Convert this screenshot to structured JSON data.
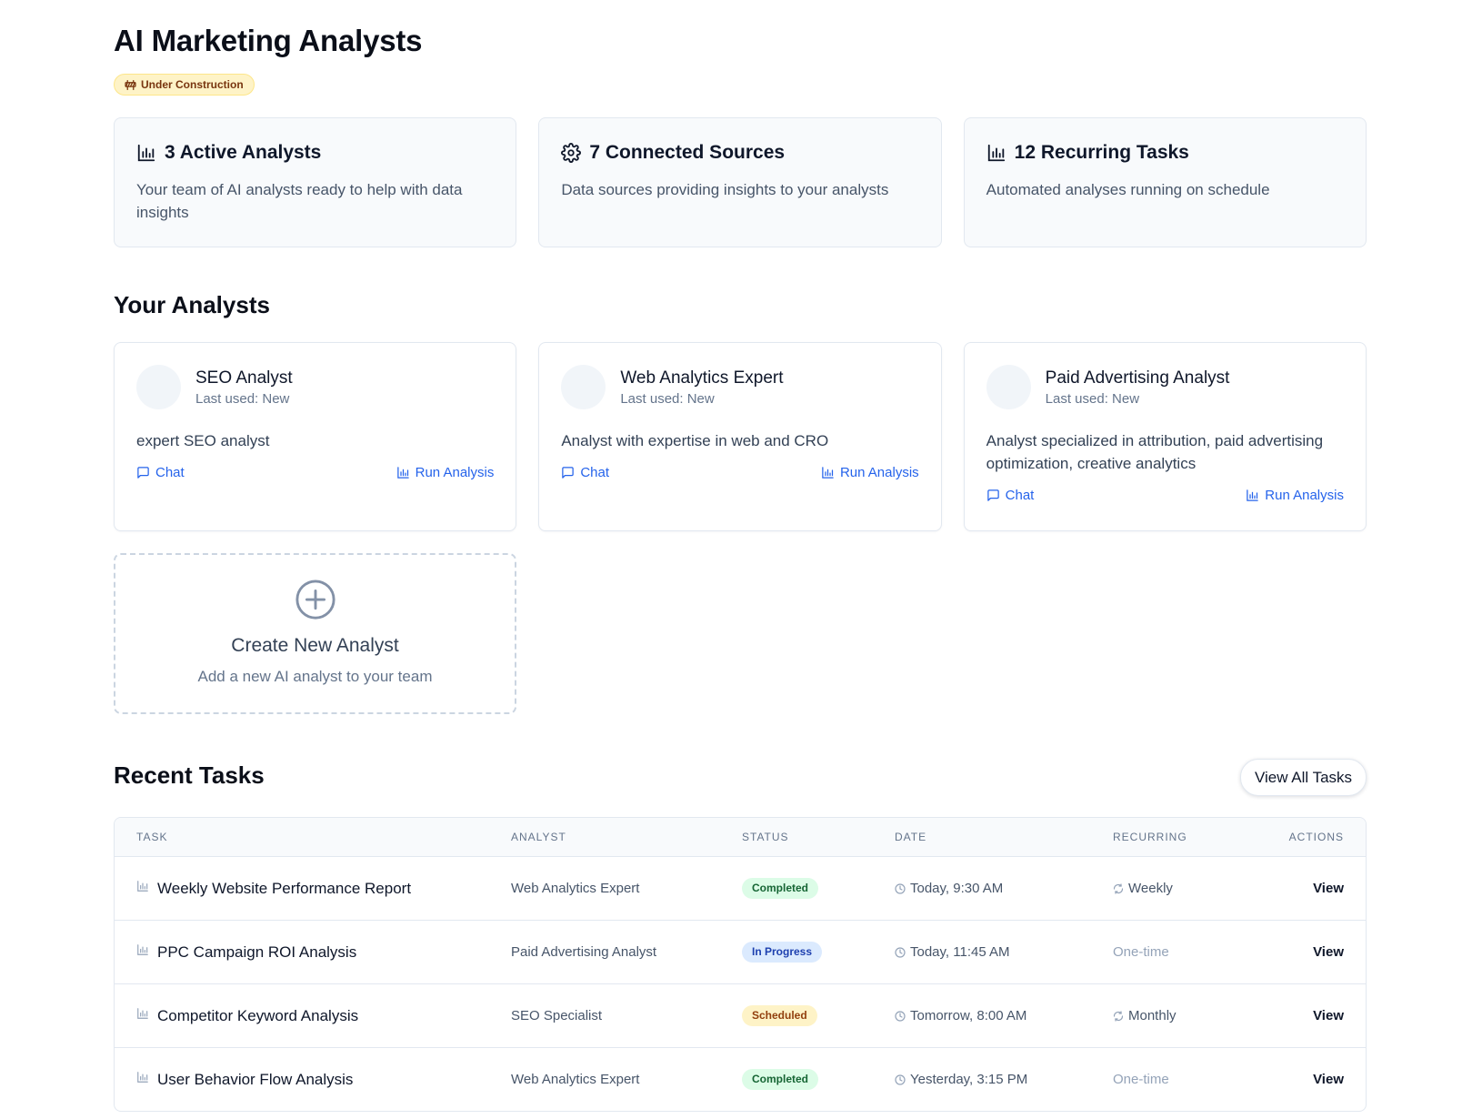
{
  "page": {
    "title": "AI Marketing Analysts",
    "badge": "Under Construction"
  },
  "stats": [
    {
      "icon": "bar-chart-icon",
      "title": "3 Active Analysts",
      "desc": "Your team of AI analysts ready to help with data insights"
    },
    {
      "icon": "gear-icon",
      "title": "7 Connected Sources",
      "desc": "Data sources providing insights to your analysts"
    },
    {
      "icon": "bar-chart-icon",
      "title": "12 Recurring Tasks",
      "desc": "Automated analyses running on schedule"
    }
  ],
  "analysts_section": {
    "title": "Your Analysts",
    "chat_label": "Chat",
    "run_label": "Run Analysis",
    "items": [
      {
        "name": "SEO Analyst",
        "last_used": "Last used: New",
        "desc": "expert SEO analyst"
      },
      {
        "name": "Web Analytics Expert",
        "last_used": "Last used: New",
        "desc": "Analyst with expertise in web and CRO"
      },
      {
        "name": "Paid Advertising Analyst",
        "last_used": "Last used: New",
        "desc": "Analyst specialized in attribution, paid advertising optimization, creative analytics"
      }
    ],
    "create": {
      "title": "Create New Analyst",
      "subtitle": "Add a new AI analyst to your team"
    }
  },
  "tasks_section": {
    "title": "Recent Tasks",
    "view_all_label": "View All Tasks",
    "columns": [
      "TASK",
      "ANALYST",
      "STATUS",
      "DATE",
      "RECURRING",
      "ACTIONS"
    ],
    "action_label": "View",
    "rows": [
      {
        "task": "Weekly Website Performance Report",
        "analyst": "Web Analytics Expert",
        "status": "Completed",
        "date": "Today, 9:30 AM",
        "recurring": "Weekly"
      },
      {
        "task": "PPC Campaign ROI Analysis",
        "analyst": "Paid Advertising Analyst",
        "status": "In Progress",
        "date": "Today, 11:45 AM",
        "recurring": "One-time"
      },
      {
        "task": "Competitor Keyword Analysis",
        "analyst": "SEO Specialist",
        "status": "Scheduled",
        "date": "Tomorrow, 8:00 AM",
        "recurring": "Monthly"
      },
      {
        "task": "User Behavior Flow Analysis",
        "analyst": "Web Analytics Expert",
        "status": "Completed",
        "date": "Yesterday, 3:15 PM",
        "recurring": "One-time"
      }
    ]
  },
  "colors": {
    "accent": "#2563eb",
    "badge_bg": "#fef3c7",
    "completed": "#dcfce7",
    "in_progress": "#dbeafe",
    "scheduled": "#fef3c7"
  }
}
